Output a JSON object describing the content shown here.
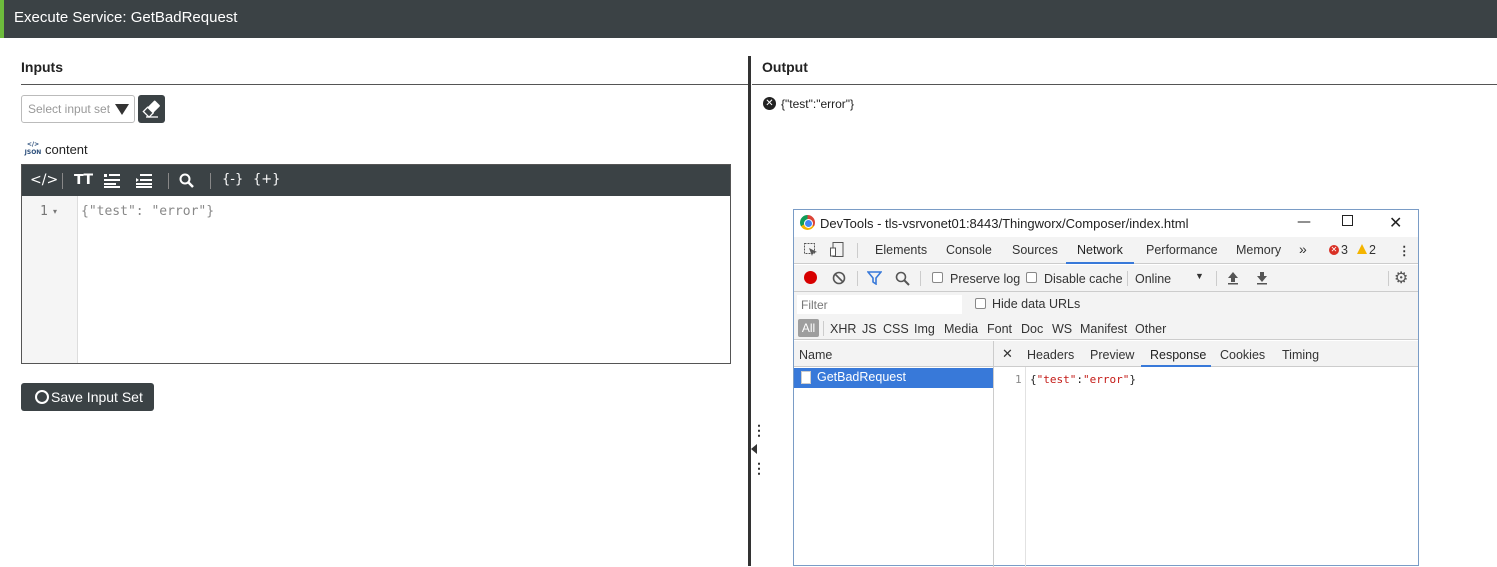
{
  "window": {
    "title": "Execute Service: GetBadRequest"
  },
  "inputs": {
    "heading": "Inputs",
    "select_placeholder": "Select input set",
    "param_icon_label": "</>\nJSON",
    "param_name": "content",
    "editor": {
      "line_numbers": [
        "1"
      ],
      "code": "{\"test\": \"error\"}"
    },
    "save_label": "Save Input Set"
  },
  "output": {
    "heading": "Output",
    "result": "{\"test\":\"error\"}"
  },
  "devtools": {
    "title": "DevTools - tls-vsrvonet01:8443/Thingworx/Composer/index.html",
    "tabs": [
      "Elements",
      "Console",
      "Sources",
      "Network",
      "Performance",
      "Memory"
    ],
    "active_tab": "Network",
    "more": "»",
    "error_count": "3",
    "warning_count": "2",
    "toolbar": {
      "preserve_log": "Preserve log",
      "disable_cache": "Disable cache",
      "throttle": "Online"
    },
    "filter_placeholder": "Filter",
    "hide_data_urls": "Hide data URLs",
    "types": [
      "All",
      "XHR",
      "JS",
      "CSS",
      "Img",
      "Media",
      "Font",
      "Doc",
      "WS",
      "Manifest",
      "Other"
    ],
    "list_header": "Name",
    "detail_tabs": [
      "Headers",
      "Preview",
      "Response",
      "Cookies",
      "Timing"
    ],
    "active_detail_tab": "Response",
    "request_name": "GetBadRequest",
    "response_line_no": "1",
    "response": {
      "open": "{",
      "key": "\"test\"",
      "colon": ":",
      "value": "\"error\"",
      "close": "}"
    }
  },
  "colors": {
    "header_bg": "#3b4245",
    "accent_green": "#6dbb3c",
    "devtools_blue": "#3879d9",
    "record_red": "#d70000"
  }
}
